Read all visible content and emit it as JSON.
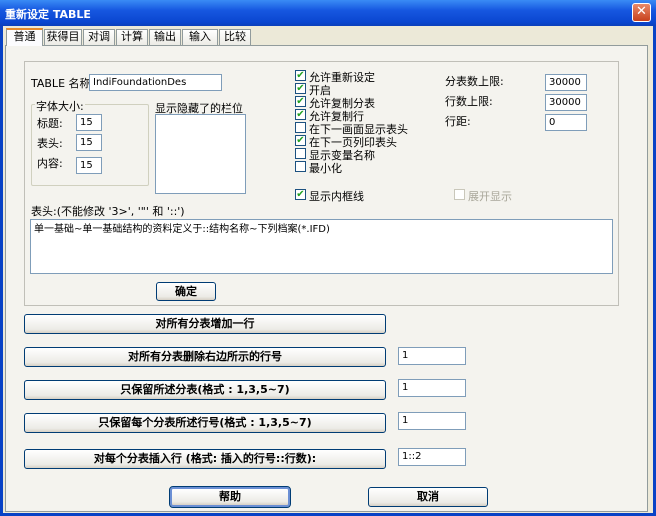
{
  "window": {
    "title": "重新设定 TABLE",
    "close_label": "✕"
  },
  "tabs": [
    {
      "label": "普通",
      "active": true
    },
    {
      "label": "获得目"
    },
    {
      "label": "对调"
    },
    {
      "label": "计算"
    },
    {
      "label": "输出"
    },
    {
      "label": "输入"
    },
    {
      "label": "比较"
    }
  ],
  "form": {
    "table_name_label": "TABLE 名称:",
    "table_name_value": "IndiFoundationDes",
    "font_size_group": "字体大小:",
    "font_title_label": "标题:",
    "font_title_value": "15",
    "font_header_label": "表头:",
    "font_header_value": "15",
    "font_content_label": "内容:",
    "font_content_value": "15",
    "hidden_columns_label": "显示隐藏了的栏位",
    "header_note_label": "表头:(不能修改 '3>', '\"' 和 '::')",
    "header_text": "单一基础~单一基础结构的资料定义于::结构名称~下列档案(*.IFD)",
    "confirm_label": "确定"
  },
  "checkboxes": [
    {
      "label": "允许重新设定",
      "checked": true
    },
    {
      "label": "开启",
      "checked": true
    },
    {
      "label": "允许复制分表",
      "checked": true
    },
    {
      "label": "允许复制行",
      "checked": true
    },
    {
      "label": "在下一画面显示表头",
      "checked": false
    },
    {
      "label": "在下一页列印表头",
      "checked": true
    },
    {
      "label": "显示变量名称",
      "checked": false
    },
    {
      "label": "最小化",
      "checked": false
    }
  ],
  "inner_border": {
    "label": "显示内框线",
    "checked": true
  },
  "expand_display": {
    "label": "展开显示",
    "checked": false,
    "disabled": true
  },
  "limits": {
    "max_subtables_label": "分表数上限:",
    "max_subtables_value": "30000",
    "max_rows_label": "行数上限:",
    "max_rows_value": "30000",
    "spacing_label": "行距:",
    "spacing_value": "0"
  },
  "actions": [
    {
      "label": "对所有分表增加一行",
      "value": null
    },
    {
      "label": "对所有分表删除右边所示的行号",
      "value": "1"
    },
    {
      "label": "只保留所述分表(格式 : 1,3,5~7)",
      "value": "1"
    },
    {
      "label": "只保留每个分表所述行号(格式 : 1,3,5~7)",
      "value": "1"
    },
    {
      "label": "对每个分表插入行 (格式: 插入的行号::行数):",
      "value": "1::2"
    }
  ],
  "footer": {
    "help_label": "帮助",
    "cancel_label": "取消"
  }
}
